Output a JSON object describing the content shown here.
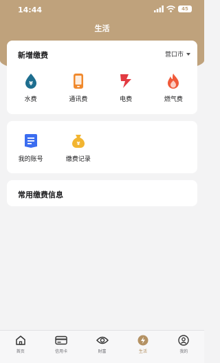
{
  "status_bar": {
    "time": "14:44",
    "battery": "45"
  },
  "header": {
    "title": "生活"
  },
  "payment_card": {
    "title": "新增缴费",
    "city": "营口市",
    "items": [
      {
        "label": "水费",
        "icon": "water-drop-icon",
        "color": "#1e6e8f"
      },
      {
        "label": "通讯费",
        "icon": "phone-icon",
        "color": "#f0892d"
      },
      {
        "label": "电费",
        "icon": "lightning-icon",
        "color": "#e23b42"
      },
      {
        "label": "燃气费",
        "icon": "flame-icon",
        "color": "#f05a3a"
      }
    ]
  },
  "account_card": {
    "items": [
      {
        "label": "我的账号",
        "icon": "document-icon",
        "color": "#3b6df0"
      },
      {
        "label": "缴费记录",
        "icon": "money-bag-icon",
        "color": "#f2b531"
      }
    ]
  },
  "frequent_card": {
    "title": "常用缴费信息"
  },
  "tabbar": {
    "tabs": [
      {
        "label": "首页",
        "icon": "home-icon"
      },
      {
        "label": "信用卡",
        "icon": "credit-card-icon"
      },
      {
        "label": "财富",
        "icon": "eye-icon"
      },
      {
        "label": "生活",
        "icon": "life-icon",
        "active": true
      },
      {
        "label": "我的",
        "icon": "profile-icon"
      }
    ]
  },
  "colors": {
    "brand": "#bfa27c",
    "active_tab": "#b49264"
  }
}
